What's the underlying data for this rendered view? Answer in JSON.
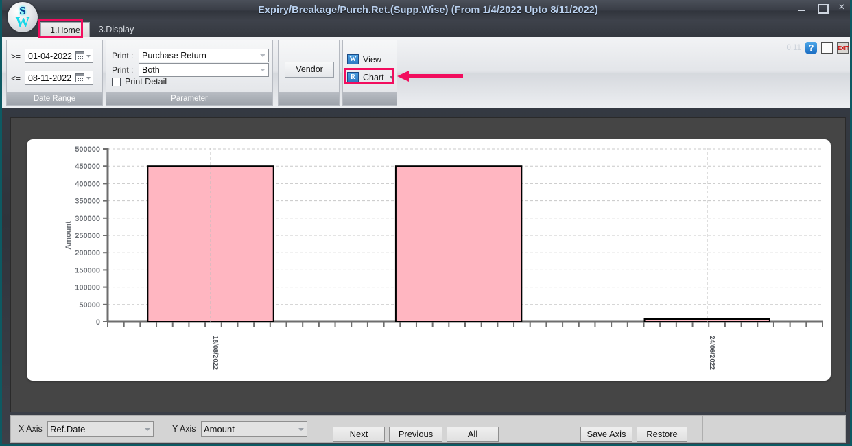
{
  "window": {
    "title": "Expiry/Breakage/Purch.Ret.(Supp.Wise) (From 1/4/2022 Upto 8/11/2022)",
    "logo_top": "S",
    "logo_bottom": "W",
    "minimize_label": "Minimize",
    "maximize_label": "Maximize",
    "close_label": "×"
  },
  "ribbon": {
    "tabs": [
      {
        "label": "1.Home",
        "active": true
      },
      {
        "label": "3.Display",
        "active": false
      }
    ],
    "version": "0.11",
    "help_icon_glyph": "?",
    "doc_icon_name": "document-icon",
    "exit_icon_label": "EXIT",
    "date_group": {
      "caption": "Date Range",
      "from_operator": ">=",
      "from_value": "01-04-2022",
      "to_operator": "<=",
      "to_value": "08-11-2022"
    },
    "parameter_group": {
      "caption": "Parameter",
      "print_type_label": "Print :",
      "print_type_value": "Purchase Return",
      "print_mode_label": "Print :",
      "print_mode_value": "Both",
      "print_detail_label": "Print Detail",
      "print_detail_checked": false
    },
    "vendor_group": {
      "caption": "",
      "button_label": "Vendor"
    },
    "action_group": {
      "caption": "",
      "view_label": "View",
      "view_icon_glyph": "W",
      "chart_label": "Chart",
      "chart_icon_glyph": "R"
    },
    "highlight_color": "#f20d5e"
  },
  "chart_data": {
    "type": "bar",
    "title": "",
    "xlabel": "Ref.Date",
    "ylabel": "Amount",
    "ylim": [
      0,
      500000
    ],
    "y_ticks": [
      0,
      50000,
      100000,
      150000,
      200000,
      250000,
      300000,
      350000,
      400000,
      450000,
      500000
    ],
    "y_tick_labels": [
      "0",
      "50000",
      "100000",
      "150000",
      "200000",
      "250000",
      "300000",
      "350000",
      "400000",
      "450000",
      "500000"
    ],
    "categories": [
      "18/08/2022",
      "24/06/2022"
    ],
    "x_tick_labels": [
      "18/08/2022",
      "24/06/2022"
    ],
    "values": [
      450000,
      450000
    ],
    "bars": [
      {
        "label": "18/08/2022",
        "value": 450000,
        "x0_pct": 5.6,
        "x1_pct": 23.2
      },
      {
        "label": "",
        "value": 450000,
        "x0_pct": 40.3,
        "x1_pct": 57.9
      },
      {
        "label": "24/06/2022",
        "value": 1500,
        "x0_pct": 75.1,
        "x1_pct": 92.6
      }
    ],
    "bar_color": "#ffb6c1",
    "bar_border_color": "#000000",
    "grid": true,
    "legend": false
  },
  "bottom_bar": {
    "x_axis_label": "X Axis",
    "x_axis_value": "Ref.Date",
    "y_axis_label": "Y Axis",
    "y_axis_value": "Amount",
    "next_label": "Next",
    "previous_label": "Previous",
    "all_label": "All",
    "save_axis_label": "Save Axis",
    "restore_label": "Restore"
  }
}
